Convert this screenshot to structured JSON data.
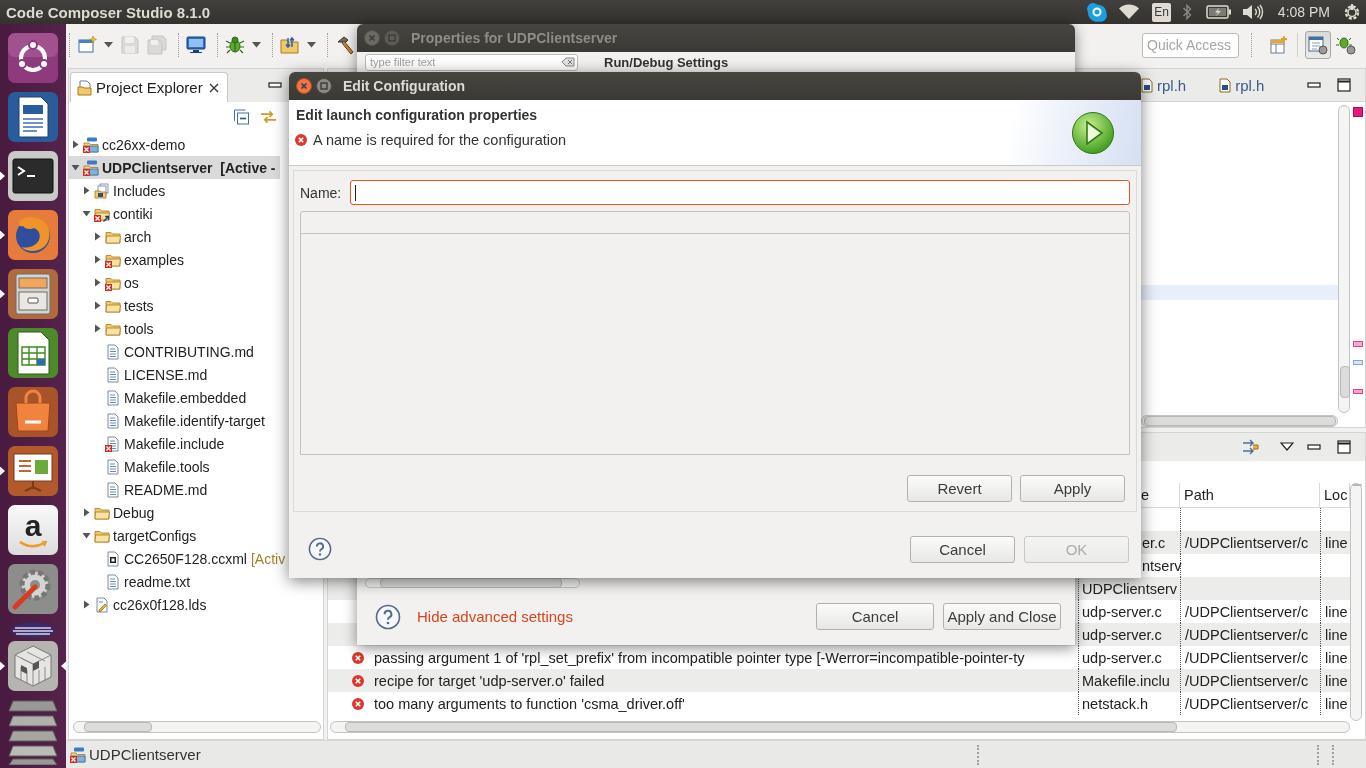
{
  "top_panel": {
    "title": "Code Composer Studio 8.1.0",
    "keyboard_layout": "En",
    "clock": "4:08 PM"
  },
  "launcher": {
    "items": [
      {
        "kind": "dash",
        "running": false,
        "focused": false
      },
      {
        "kind": "document",
        "running": false,
        "focused": false
      },
      {
        "kind": "terminal",
        "running": true,
        "focused": false
      },
      {
        "kind": "browser",
        "running": true,
        "focused": false
      },
      {
        "kind": "files",
        "running": true,
        "focused": false
      },
      {
        "kind": "spreadsheet",
        "running": false,
        "focused": false
      },
      {
        "kind": "store",
        "running": false,
        "focused": false
      },
      {
        "kind": "slides",
        "running": true,
        "focused": false
      },
      {
        "kind": "shop",
        "running": false,
        "focused": false,
        "letter": "a"
      },
      {
        "kind": "settings",
        "running": false,
        "focused": false
      },
      {
        "kind": "ide",
        "running": false,
        "focused": false
      },
      {
        "kind": "workspaces",
        "running": true,
        "focused": true
      },
      {
        "kind": "folded",
        "running": false,
        "focused": false
      }
    ]
  },
  "toolbar": {
    "groups": [
      [
        {
          "kind": "new",
          "disabled": false,
          "menu": true
        },
        {
          "kind": "save",
          "disabled": true,
          "menu": false
        },
        {
          "kind": "save-all",
          "disabled": true,
          "menu": false
        }
      ],
      [
        {
          "kind": "terminal",
          "disabled": false,
          "menu": false
        }
      ],
      [
        {
          "kind": "debug",
          "disabled": false,
          "menu": true
        }
      ],
      [
        {
          "kind": "import",
          "disabled": false,
          "menu": true
        }
      ],
      [
        {
          "kind": "build",
          "disabled": false,
          "menu": false
        }
      ]
    ],
    "quick_access": {
      "placeholder": "Quick Access"
    },
    "perspectives": [
      {
        "kind": "open",
        "selected": false
      },
      {
        "kind": "edit",
        "selected": true
      },
      {
        "kind": "debug",
        "selected": false
      }
    ]
  },
  "project_explorer": {
    "tab": {
      "label": "Project Explorer"
    },
    "tree": [
      {
        "label": "cc26xx-demo",
        "kind": "project",
        "active": false,
        "expandable": true,
        "expanded": false,
        "error": true,
        "selected": false
      },
      {
        "label": "UDPClientserver  [Active -",
        "kind": "project",
        "active": true,
        "expandable": true,
        "expanded": true,
        "error": true,
        "selected": true,
        "children": [
          {
            "label": "Includes",
            "kind": "includes",
            "expandable": true,
            "expanded": false,
            "error": false,
            "selected": false
          },
          {
            "label": "contiki",
            "kind": "linked-folder",
            "expandable": true,
            "expanded": true,
            "error": true,
            "selected": false,
            "children": [
              {
                "label": "arch",
                "kind": "folder",
                "expandable": true,
                "expanded": false,
                "error": false,
                "selected": false
              },
              {
                "label": "examples",
                "kind": "folder",
                "expandable": true,
                "expanded": false,
                "error": true,
                "selected": false
              },
              {
                "label": "os",
                "kind": "folder",
                "expandable": true,
                "expanded": false,
                "error": true,
                "selected": false
              },
              {
                "label": "tests",
                "kind": "folder",
                "expandable": true,
                "expanded": false,
                "error": false,
                "selected": false
              },
              {
                "label": "tools",
                "kind": "folder",
                "expandable": true,
                "expanded": false,
                "error": false,
                "selected": false
              },
              {
                "label": "CONTRIBUTING.md",
                "kind": "file",
                "expandable": false,
                "expanded": false,
                "error": false,
                "selected": false
              },
              {
                "label": "LICENSE.md",
                "kind": "file",
                "expandable": false,
                "expanded": false,
                "error": false,
                "selected": false
              },
              {
                "label": "Makefile.embedded",
                "kind": "file",
                "expandable": false,
                "expanded": false,
                "error": false,
                "selected": false
              },
              {
                "label": "Makefile.identify-target",
                "kind": "file",
                "expandable": false,
                "expanded": false,
                "error": false,
                "selected": false
              },
              {
                "label": "Makefile.include",
                "kind": "file",
                "expandable": false,
                "expanded": false,
                "error": true,
                "selected": false
              },
              {
                "label": "Makefile.tools",
                "kind": "file",
                "expandable": false,
                "expanded": false,
                "error": false,
                "selected": false
              },
              {
                "label": "README.md",
                "kind": "file",
                "expandable": false,
                "expanded": false,
                "error": false,
                "selected": false
              }
            ]
          },
          {
            "label": "Debug",
            "kind": "folder",
            "expandable": true,
            "expanded": false,
            "error": false,
            "selected": false
          },
          {
            "label": "targetConfigs",
            "kind": "folder",
            "expandable": true,
            "expanded": true,
            "error": false,
            "selected": false,
            "children": [
              {
                "label": "CC2650F128.ccxml",
                "decoration": "[Activ",
                "kind": "target-config",
                "expandable": false,
                "expanded": false,
                "error": false,
                "selected": false
              },
              {
                "label": "readme.txt",
                "kind": "file",
                "expandable": false,
                "expanded": false,
                "error": false,
                "selected": false
              }
            ]
          },
          {
            "label": "cc26x0f128.lds",
            "kind": "linker-script",
            "expandable": true,
            "expanded": false,
            "error": false,
            "selected": false
          }
        ]
      }
    ]
  },
  "editor": {
    "tabs": [
      {
        "label": "rpl.h"
      },
      {
        "label": "rpl.h"
      }
    ]
  },
  "problems": {
    "columns": [
      "e",
      "Path",
      "Loc"
    ],
    "rows": [
      {
        "resource": "er.c",
        "path": "/UDPClientserver/c",
        "location": "line"
      },
      {
        "resource": "ntserv"
      },
      {
        "resource": "UDPClientserv"
      },
      {
        "resource": "udp-server.c",
        "path": "/UDPClientserver/c",
        "location": "line"
      },
      {
        "resource": "udp-server.c",
        "path": "/UDPClientserver/c",
        "location": "line"
      },
      {
        "error": true,
        "description": "passing argument 1 of 'rpl_set_prefix' from incompatible pointer type [-Werror=incompatible-pointer-ty",
        "resource": "udp-server.c",
        "path": "/UDPClientserver/c",
        "location": "line"
      },
      {
        "error": true,
        "description": "recipe for target 'udp-server.o' failed",
        "resource": "Makefile.inclu",
        "path": "/UDPClientserver/c",
        "location": "line"
      },
      {
        "error": true,
        "description": "too many arguments to function 'csma_driver.off'",
        "resource": "netstack.h",
        "path": "/UDPClientserver/c",
        "location": "line"
      }
    ]
  },
  "status_bar": {
    "label": "UDPClientserver"
  },
  "properties_dialog": {
    "title": "Properties for UDPClientserver",
    "active": false,
    "filter": {
      "placeholder": "type filter text"
    },
    "page_title": "Run/Debug Settings",
    "advanced_link": "Hide advanced settings",
    "buttons": [
      {
        "label": "Cancel",
        "disabled": false
      },
      {
        "label": "Apply and Close",
        "disabled": false
      }
    ]
  },
  "edit_dialog": {
    "title": "Edit Configuration",
    "active": true,
    "heading": "Edit launch configuration properties",
    "message": {
      "error": true,
      "text": "A name is required for the configuration"
    },
    "name_field": {
      "label": "Name:",
      "focused": true
    },
    "tab_buttons": [
      {
        "label": "Revert",
        "disabled": false
      },
      {
        "label": "Apply",
        "disabled": false
      }
    ],
    "buttons": [
      {
        "label": "Cancel",
        "disabled": false
      },
      {
        "label": "OK",
        "disabled": true
      }
    ]
  }
}
